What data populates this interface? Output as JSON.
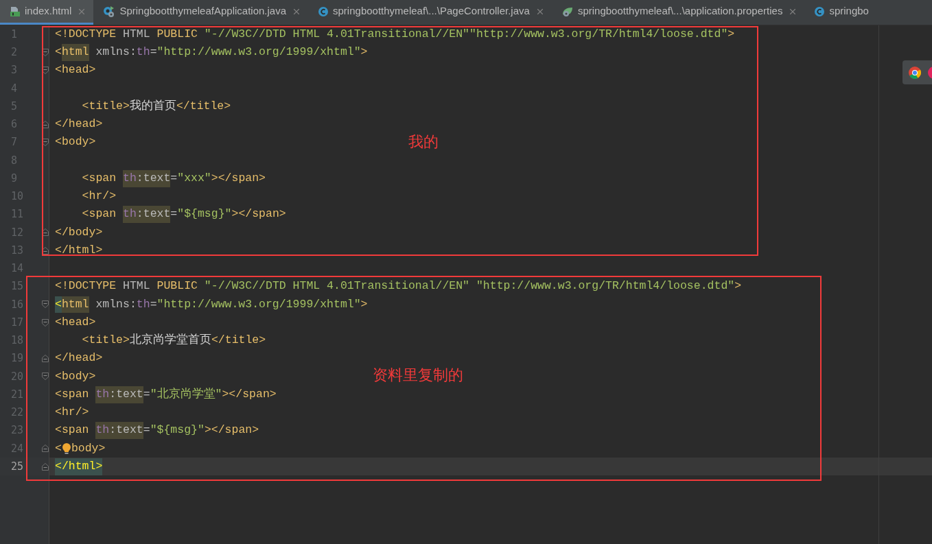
{
  "tabs": [
    {
      "label": "index.html",
      "kind": "html",
      "selected": true,
      "closable": true
    },
    {
      "label": "SpringbootthymeleafApplication.java",
      "kind": "app",
      "selected": false,
      "closable": true
    },
    {
      "label": "springbootthymeleaf\\...\\PageController.java",
      "kind": "class",
      "selected": false,
      "closable": true
    },
    {
      "label": "springbootthymeleaf\\...\\application.properties",
      "kind": "properties",
      "selected": false,
      "closable": true
    },
    {
      "label": "springbo",
      "kind": "class",
      "selected": false,
      "closable": false
    }
  ],
  "lines": [
    {
      "number": "1",
      "current": false,
      "kind": "plain",
      "tokens": [
        {
          "kind": "tag",
          "text": "<!DOCTYPE "
        },
        {
          "kind": "attr",
          "text": "HTML "
        },
        {
          "kind": "tag",
          "text": "PUBLIC "
        },
        {
          "kind": "string",
          "text": "\"-//W3C//DTD HTML 4.01Transitional//EN\"\"http://www.w3.org/TR/html4/loose.dtd\""
        },
        {
          "kind": "tag",
          "text": ">"
        }
      ]
    },
    {
      "number": "2",
      "current": false,
      "kind": "fold-start",
      "tokens": [
        {
          "kind": "tag",
          "text": "<"
        },
        {
          "kind": "tag-highlight",
          "text": "html"
        },
        {
          "kind": "attr",
          "text": " xmlns:"
        },
        {
          "kind": "ns",
          "text": "th"
        },
        {
          "kind": "attr",
          "text": "="
        },
        {
          "kind": "string",
          "text": "\"http://www.w3.org/1999/xhtml\""
        },
        {
          "kind": "tag",
          "text": ">"
        }
      ]
    },
    {
      "number": "3",
      "current": false,
      "kind": "fold-start",
      "tokens": [
        {
          "kind": "tag",
          "text": "<head>"
        }
      ]
    },
    {
      "number": "4",
      "current": false,
      "kind": "plain"
    },
    {
      "number": "5",
      "current": false,
      "kind": "plain",
      "tokens": [
        {
          "kind": "tag",
          "text": "    <title>"
        },
        {
          "kind": "text",
          "text": "我的首页"
        },
        {
          "kind": "tag",
          "text": "</title>"
        }
      ]
    },
    {
      "number": "6",
      "current": false,
      "kind": "fold-end",
      "tokens": [
        {
          "kind": "tag",
          "text": "</head>"
        }
      ]
    },
    {
      "number": "7",
      "current": false,
      "kind": "fold-start",
      "tokens": [
        {
          "kind": "tag",
          "text": "<body>"
        }
      ]
    },
    {
      "number": "8",
      "current": false,
      "kind": "plain"
    },
    {
      "number": "9",
      "current": false,
      "kind": "plain",
      "tokens": [
        {
          "kind": "tag",
          "text": "    <span "
        },
        {
          "kind": "ns-highlight",
          "text": "th"
        },
        {
          "kind": "attr-highlight",
          "text": ":text"
        },
        {
          "kind": "attr",
          "text": "="
        },
        {
          "kind": "string",
          "text": "\"xxx\""
        },
        {
          "kind": "tag",
          "text": "></span>"
        }
      ]
    },
    {
      "number": "10",
      "current": false,
      "kind": "plain",
      "tokens": [
        {
          "kind": "tag",
          "text": "    <hr/>"
        }
      ]
    },
    {
      "number": "11",
      "current": false,
      "kind": "plain",
      "tokens": [
        {
          "kind": "tag",
          "text": "    <span "
        },
        {
          "kind": "ns-highlight",
          "text": "th"
        },
        {
          "kind": "attr-highlight",
          "text": ":text"
        },
        {
          "kind": "attr",
          "text": "="
        },
        {
          "kind": "string",
          "text": "\"${msg}\""
        },
        {
          "kind": "tag",
          "text": "></span>"
        }
      ]
    },
    {
      "number": "12",
      "current": false,
      "kind": "fold-end",
      "tokens": [
        {
          "kind": "tag",
          "text": "</body>"
        }
      ]
    },
    {
      "number": "13",
      "current": false,
      "kind": "fold-end",
      "tokens": [
        {
          "kind": "tag",
          "text": "</html>"
        }
      ]
    },
    {
      "number": "14",
      "current": false,
      "kind": "plain"
    },
    {
      "number": "15",
      "current": false,
      "kind": "plain",
      "tokens": [
        {
          "kind": "tag",
          "text": "<!DOCTYPE "
        },
        {
          "kind": "attr",
          "text": "HTML "
        },
        {
          "kind": "tag",
          "text": "PUBLIC "
        },
        {
          "kind": "string",
          "text": "\"-//W3C//DTD HTML 4.01Transitional//EN\" \"http://www.w3.org/TR/html4/loose.dtd\""
        },
        {
          "kind": "tag",
          "text": ">"
        }
      ]
    },
    {
      "number": "16",
      "current": false,
      "kind": "fold-start",
      "tokens": [
        {
          "kind": "tag-match",
          "text": "<"
        },
        {
          "kind": "tag-highlight",
          "text": "html"
        },
        {
          "kind": "attr",
          "text": " xmlns:"
        },
        {
          "kind": "ns",
          "text": "th"
        },
        {
          "kind": "attr",
          "text": "="
        },
        {
          "kind": "string",
          "text": "\"http://www.w3.org/1999/xhtml\""
        },
        {
          "kind": "tag",
          "text": ">"
        }
      ]
    },
    {
      "number": "17",
      "current": false,
      "kind": "fold-start",
      "tokens": [
        {
          "kind": "tag",
          "text": "<head>"
        }
      ]
    },
    {
      "number": "18",
      "current": false,
      "kind": "plain",
      "tokens": [
        {
          "kind": "tag",
          "text": "    <title>"
        },
        {
          "kind": "text",
          "text": "北京尚学堂首页"
        },
        {
          "kind": "tag",
          "text": "</title>"
        }
      ]
    },
    {
      "number": "19",
      "current": false,
      "kind": "fold-end",
      "tokens": [
        {
          "kind": "tag",
          "text": "</head>"
        }
      ]
    },
    {
      "number": "20",
      "current": false,
      "kind": "fold-start",
      "tokens": [
        {
          "kind": "tag",
          "text": "<body>"
        }
      ]
    },
    {
      "number": "21",
      "current": false,
      "kind": "plain",
      "tokens": [
        {
          "kind": "tag",
          "text": "<span "
        },
        {
          "kind": "ns-highlight",
          "text": "th"
        },
        {
          "kind": "attr-highlight",
          "text": ":text"
        },
        {
          "kind": "attr",
          "text": "="
        },
        {
          "kind": "string",
          "text": "\"北京尚学堂\""
        },
        {
          "kind": "tag",
          "text": "></span>"
        }
      ]
    },
    {
      "number": "22",
      "current": false,
      "kind": "plain",
      "tokens": [
        {
          "kind": "tag",
          "text": "<hr/>"
        }
      ]
    },
    {
      "number": "23",
      "current": false,
      "kind": "plain",
      "tokens": [
        {
          "kind": "tag",
          "text": "<span "
        },
        {
          "kind": "ns-highlight",
          "text": "th"
        },
        {
          "kind": "attr-highlight",
          "text": ":text"
        },
        {
          "kind": "attr",
          "text": "="
        },
        {
          "kind": "string",
          "text": "\"${msg}\""
        },
        {
          "kind": "tag",
          "text": "></span>"
        }
      ]
    },
    {
      "number": "24",
      "current": false,
      "kind": "fold-end",
      "tokens": [
        {
          "kind": "tag",
          "text": "<"
        },
        {
          "kind": "bulb"
        },
        {
          "kind": "tag",
          "text": "body>"
        }
      ]
    },
    {
      "number": "25",
      "current": true,
      "kind": "fold-end",
      "tokens": [
        {
          "kind": "tag-match",
          "text": "</html>"
        }
      ]
    }
  ],
  "annotations": [
    {
      "label": "我的"
    },
    {
      "label": "资料里复制的"
    }
  ]
}
